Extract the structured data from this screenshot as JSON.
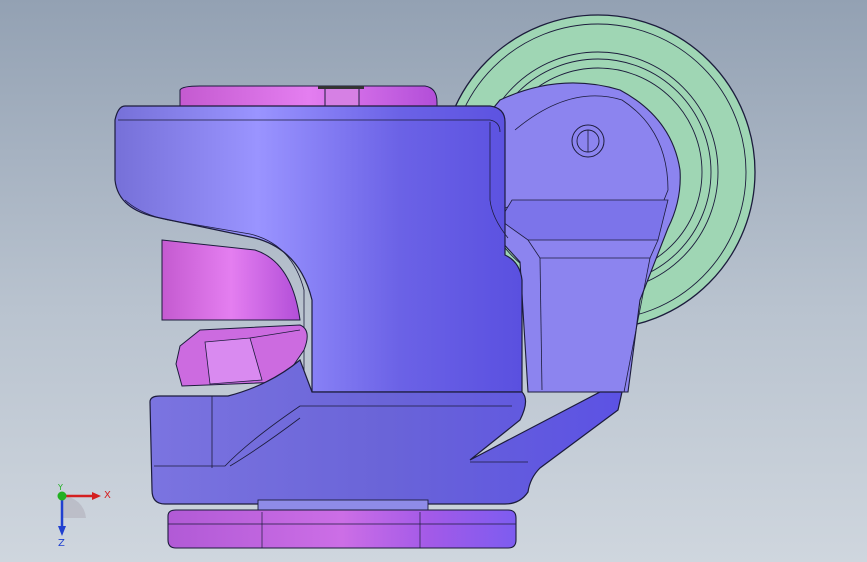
{
  "viewport": {
    "background_top": "#93a1b3",
    "background_bottom": "#cfd6de"
  },
  "model": {
    "name": "leveling-caster",
    "body_color": "#7d73e6",
    "body_highlight": "#9a94ff",
    "accent_color": "#d45fd6",
    "wheel_color": "#9fd6b4",
    "outline_color": "#1c1c3c"
  },
  "triad": {
    "x_label": "X",
    "y_label": "Y",
    "z_label": "Z",
    "x_color": "#d42020",
    "y_color": "#22b022",
    "z_color": "#2040d0"
  }
}
